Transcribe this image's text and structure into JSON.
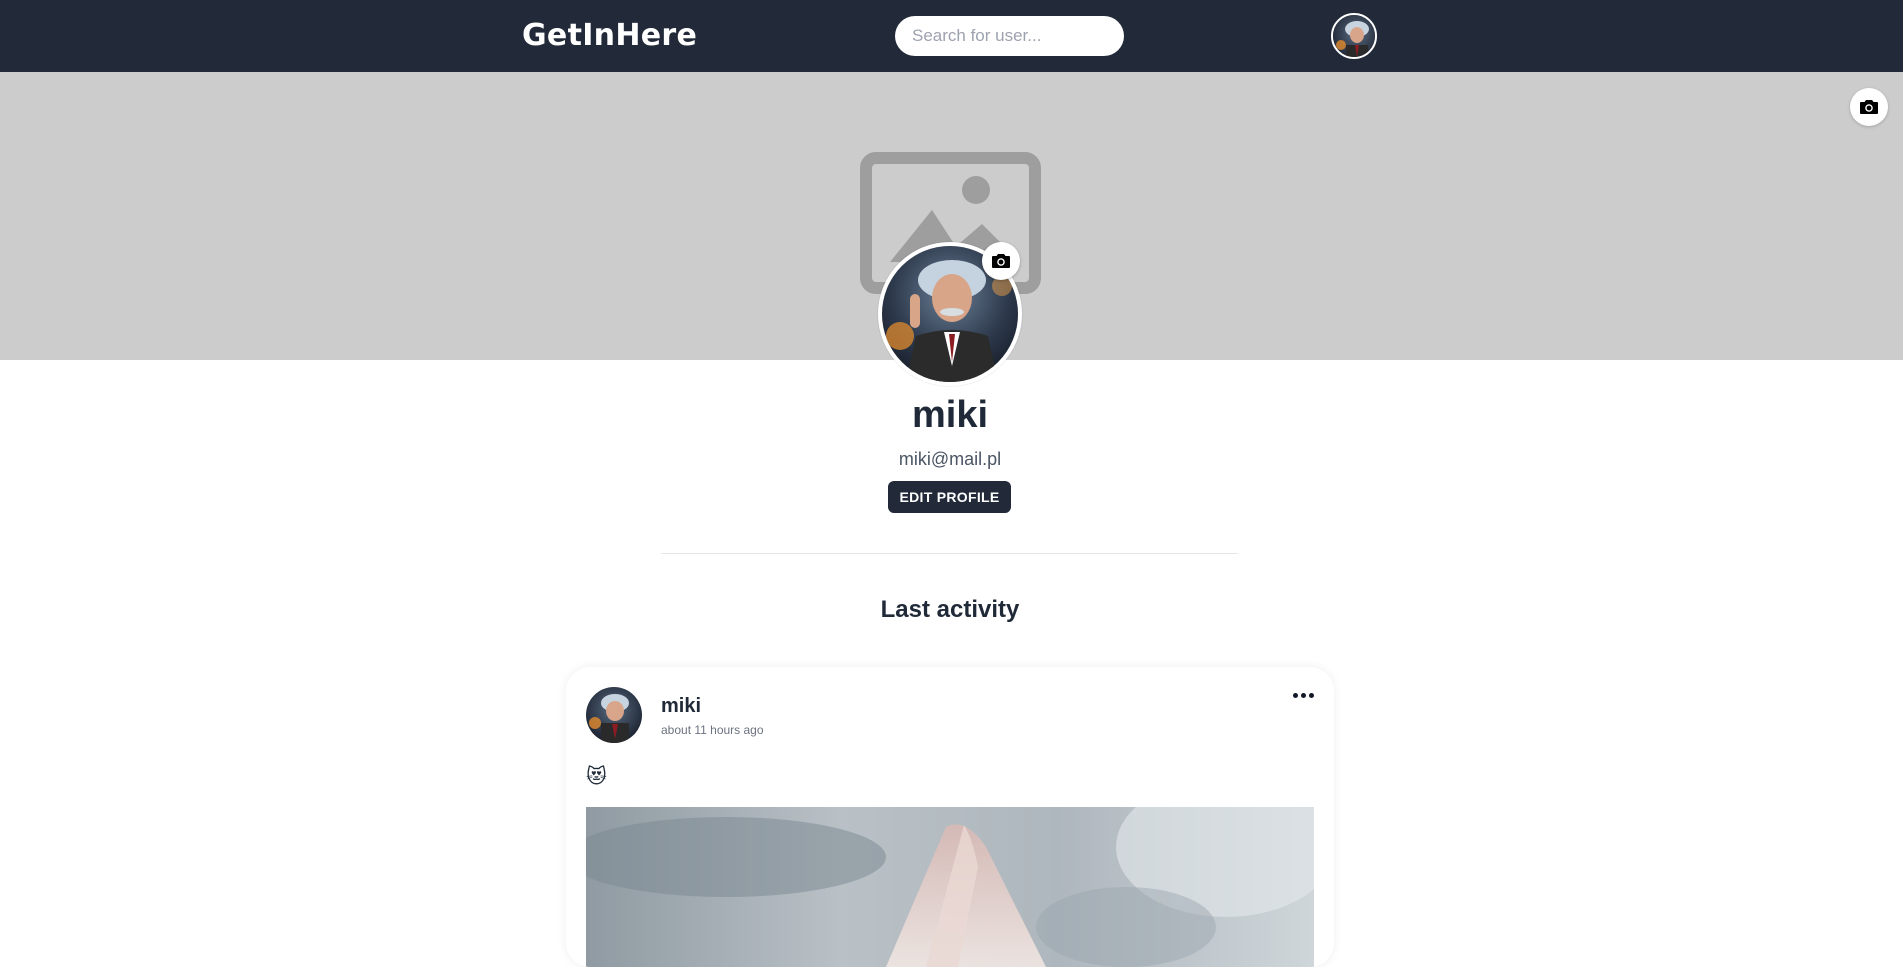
{
  "navbar": {
    "brand": "GetInHere",
    "search_placeholder": "Search for user...",
    "avatar_icon": "user-avatar-einstein"
  },
  "cover": {
    "placeholder_icon": "image-placeholder-icon",
    "camera_icon": "camera-icon"
  },
  "profile": {
    "username": "miki",
    "email": "miki@mail.pl",
    "edit_button": "EDIT PROFILE",
    "camera_icon": "camera-icon"
  },
  "activity": {
    "title": "Last activity",
    "posts": [
      {
        "author": "miki",
        "time": "about 11 hours ago",
        "content": "😻",
        "menu_icon": "more-horizontal-icon"
      }
    ]
  },
  "colors": {
    "navbar": "#222a39",
    "cover": "#cccccc",
    "button": "#222a39"
  }
}
